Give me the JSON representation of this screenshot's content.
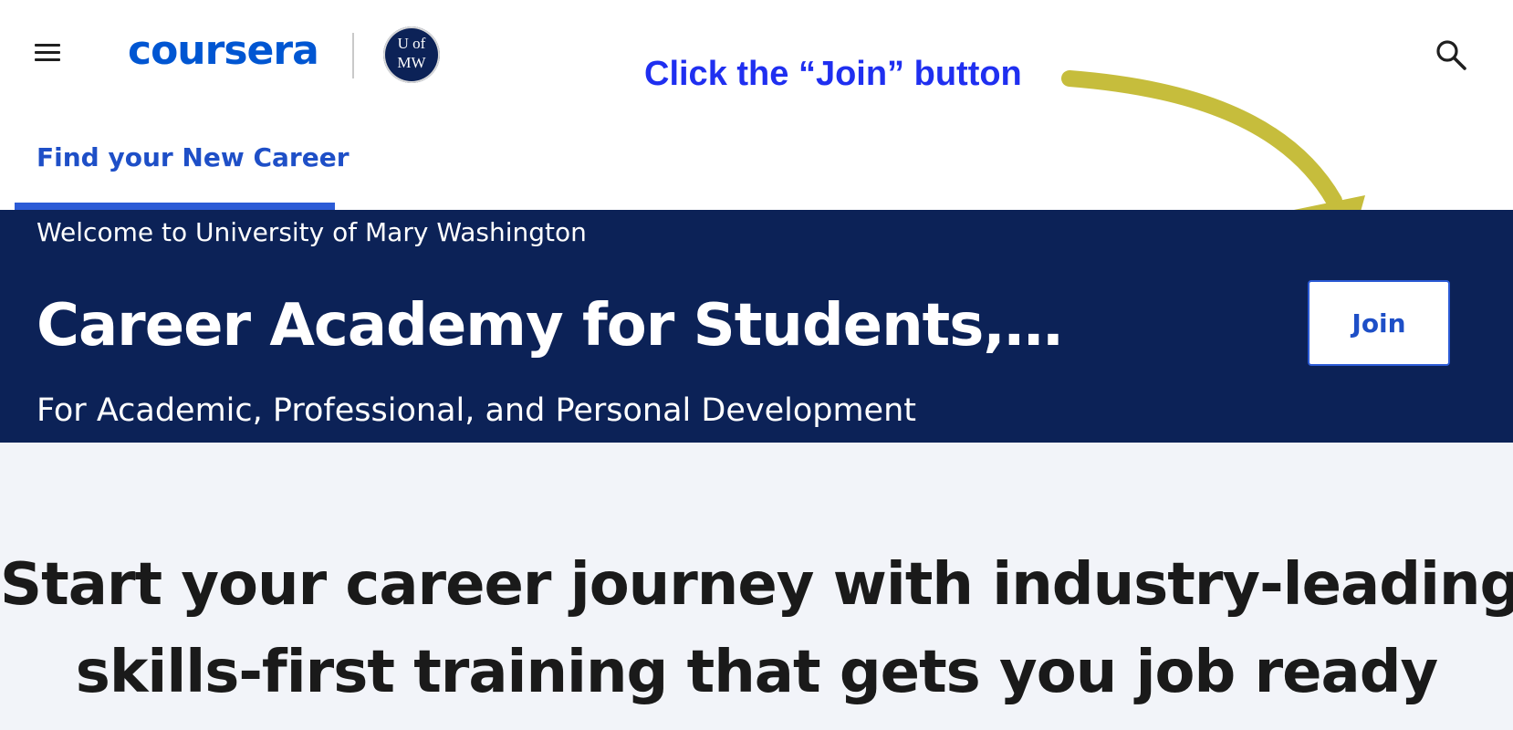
{
  "header": {
    "logo_text": "coursera",
    "seal": {
      "line1": "UofMW",
      "line1_top": "UofMW"
    },
    "seal_text_top": "U of",
    "seal_text_bottom": "MW",
    "menu_icon": "hamburger-menu-icon",
    "search_icon": "search-icon"
  },
  "annotation": {
    "text": "Click the “Join” button",
    "arrow_color": "#c6bd3c",
    "text_color": "#1f2ff0"
  },
  "tabs": [
    {
      "label": "Find your New Career",
      "active": true
    }
  ],
  "banner": {
    "welcome": "Welcome to University of Mary Washington",
    "title": "Career Academy for Students,…",
    "subtitle": "For Academic, Professional, and Personal Development",
    "join_label": "Join",
    "background": "#0c2257"
  },
  "hero": {
    "heading_line1": "Start your career journey with industry-leading,",
    "heading_line2": "skills-first training that gets you job ready"
  },
  "colors": {
    "brand": "#0056d2",
    "tab_accent": "#2c5bd6",
    "hero_bg": "#f2f4f9"
  }
}
